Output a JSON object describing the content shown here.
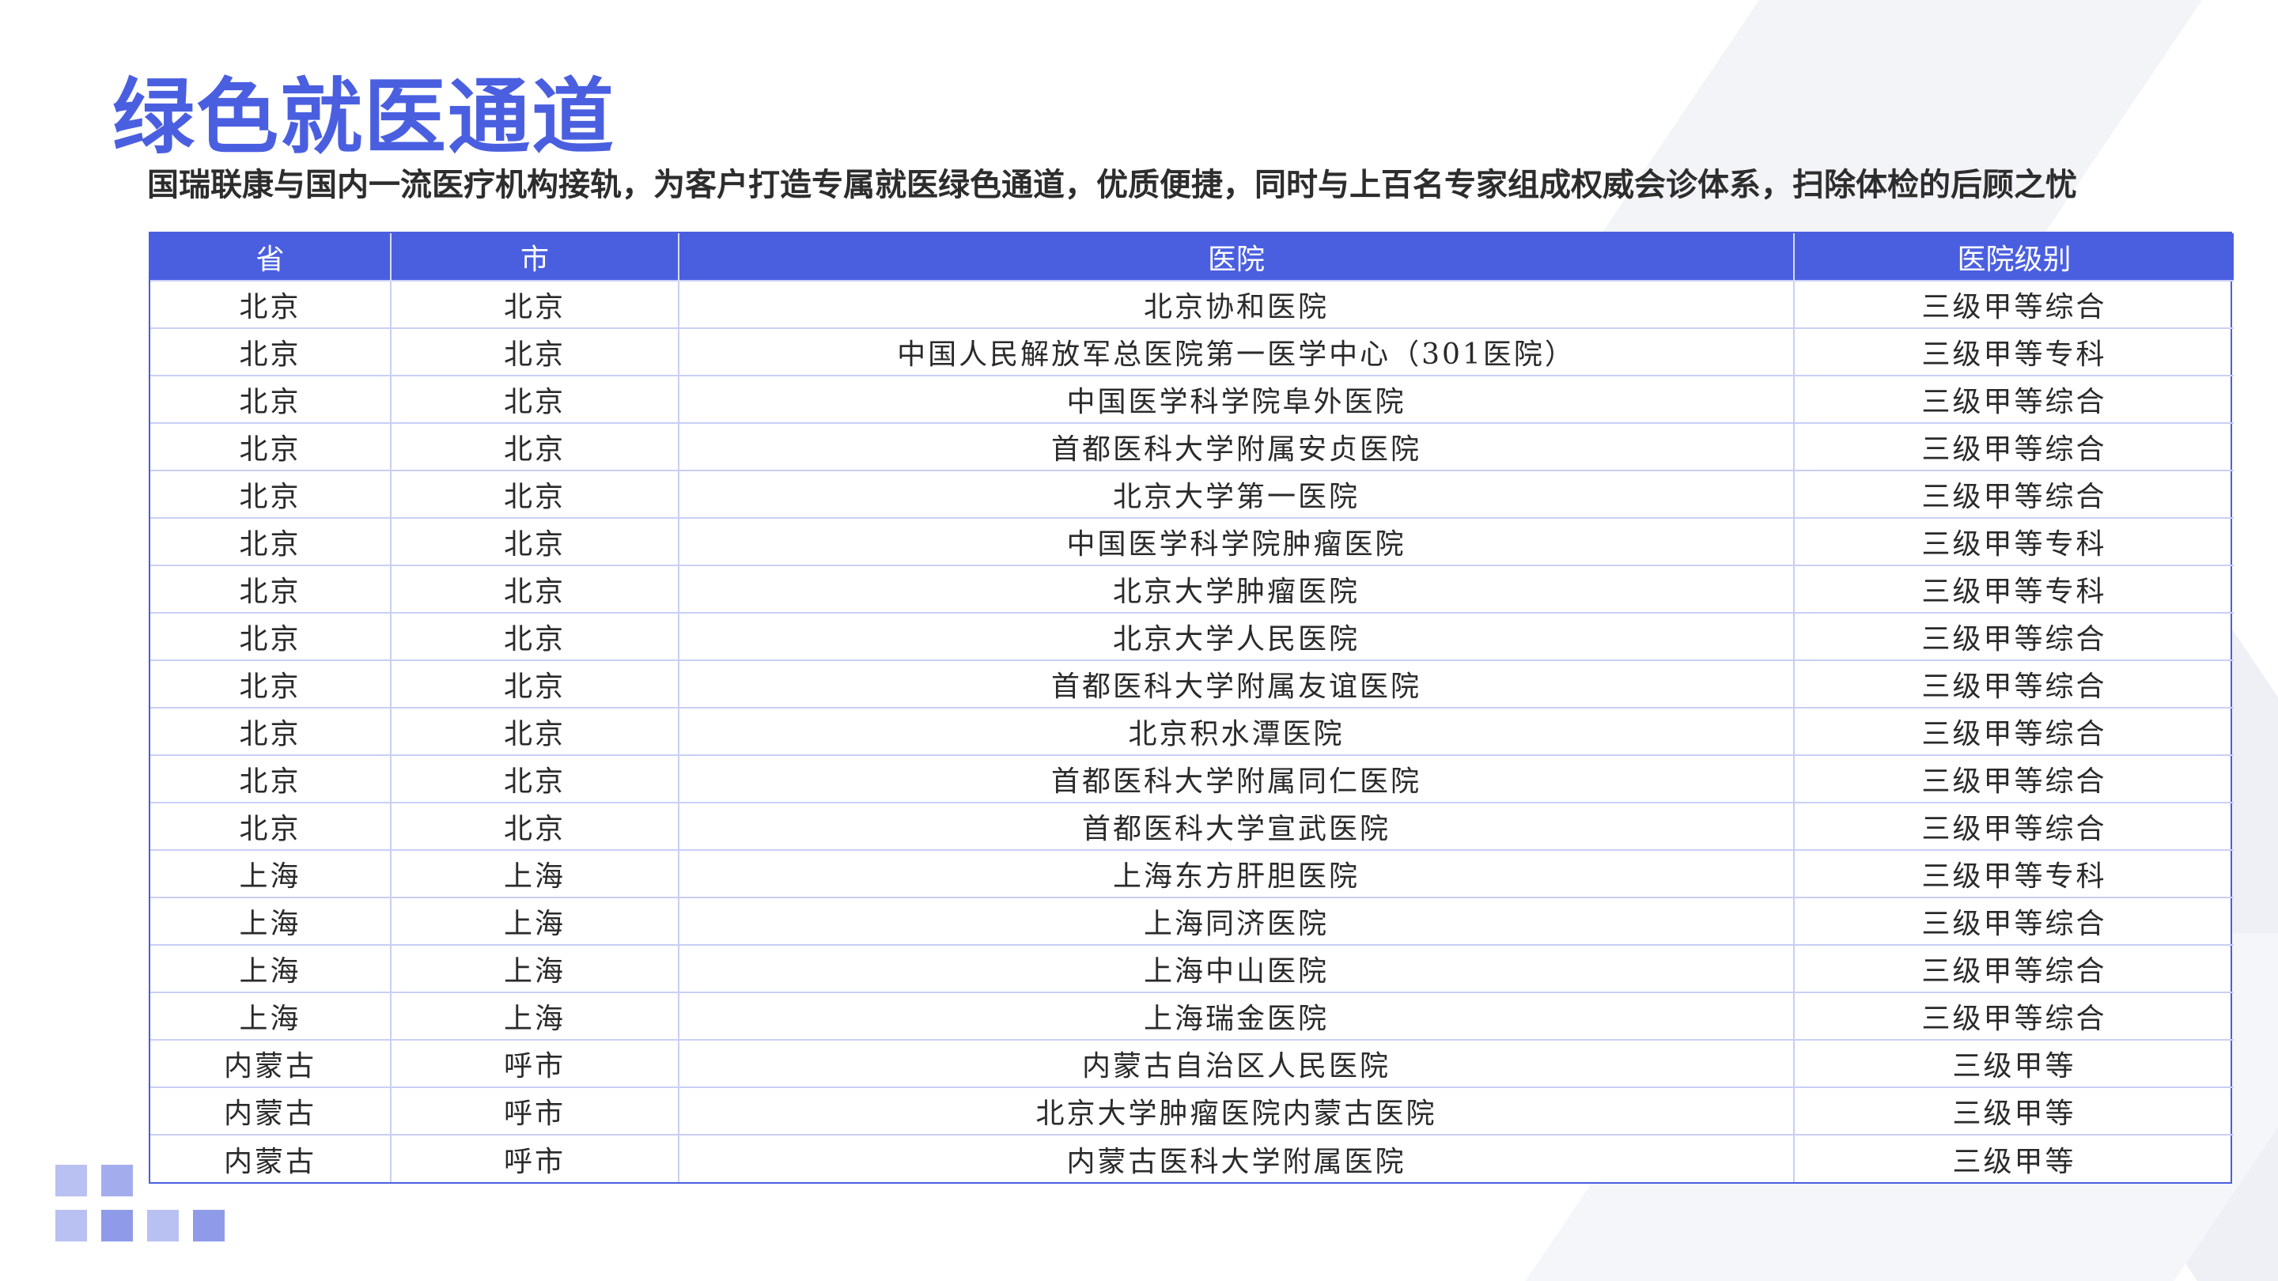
{
  "title": "绿色就医通道",
  "subtitle": "国瑞联康与国内一流医疗机构接轨，为客户打造专属就医绿色通道，优质便捷，同时与上百名专家组成权威会诊体系，扫除体检的后顾之忧",
  "colors": {
    "accent": "#4a5fe0",
    "header_text": "#ffffff",
    "border": "#c9cff5"
  },
  "table": {
    "headers": [
      "省",
      "市",
      "医院",
      "医院级别"
    ],
    "rows": [
      [
        "北京",
        "北京",
        "北京协和医院",
        "三级甲等综合"
      ],
      [
        "北京",
        "北京",
        "中国人民解放军总医院第一医学中心（301医院）",
        "三级甲等专科"
      ],
      [
        "北京",
        "北京",
        "中国医学科学院阜外医院",
        "三级甲等综合"
      ],
      [
        "北京",
        "北京",
        "首都医科大学附属安贞医院",
        "三级甲等综合"
      ],
      [
        "北京",
        "北京",
        "北京大学第一医院",
        "三级甲等综合"
      ],
      [
        "北京",
        "北京",
        "中国医学科学院肿瘤医院",
        "三级甲等专科"
      ],
      [
        "北京",
        "北京",
        "北京大学肿瘤医院",
        "三级甲等专科"
      ],
      [
        "北京",
        "北京",
        "北京大学人民医院",
        "三级甲等综合"
      ],
      [
        "北京",
        "北京",
        "首都医科大学附属友谊医院",
        "三级甲等综合"
      ],
      [
        "北京",
        "北京",
        "北京积水潭医院",
        "三级甲等综合"
      ],
      [
        "北京",
        "北京",
        "首都医科大学附属同仁医院",
        "三级甲等综合"
      ],
      [
        "北京",
        "北京",
        "首都医科大学宣武医院",
        "三级甲等综合"
      ],
      [
        "上海",
        "上海",
        "上海东方肝胆医院",
        "三级甲等专科"
      ],
      [
        "上海",
        "上海",
        "上海同济医院",
        "三级甲等综合"
      ],
      [
        "上海",
        "上海",
        "上海中山医院",
        "三级甲等综合"
      ],
      [
        "上海",
        "上海",
        "上海瑞金医院",
        "三级甲等综合"
      ],
      [
        "内蒙古",
        "呼市",
        "内蒙古自治区人民医院",
        "三级甲等"
      ],
      [
        "内蒙古",
        "呼市",
        "北京大学肿瘤医院内蒙古医院",
        "三级甲等"
      ],
      [
        "内蒙古",
        "呼市",
        "内蒙古医科大学附属医院",
        "三级甲等"
      ]
    ]
  }
}
